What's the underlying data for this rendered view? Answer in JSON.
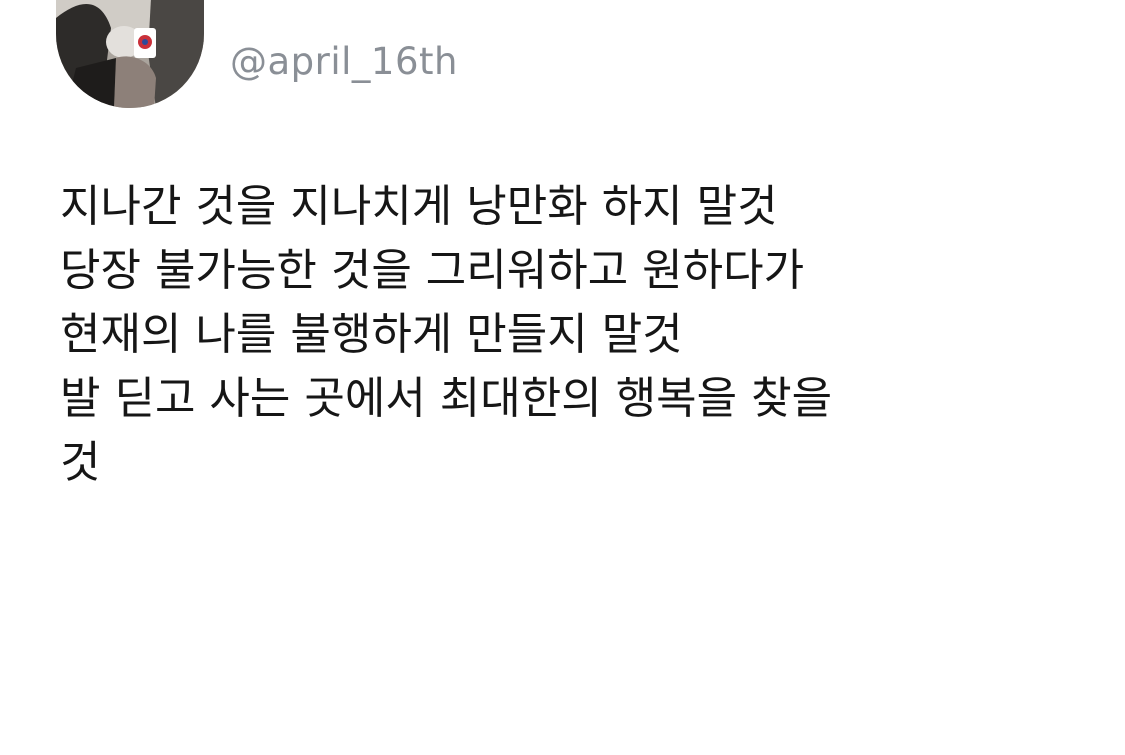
{
  "tweet": {
    "handle": "@april_16th",
    "avatar_icon": "profile-photo",
    "lines": [
      "지나간 것을 지나치게 낭만화 하지 말것",
      "당장 불가능한 것을 그리워하고 원하다가",
      "현재의 나를 불행하게 만들지 말것",
      "발 딛고 사는 곳에서 최대한의 행복을 찾을",
      "것"
    ]
  },
  "colors": {
    "background": "#ffffff",
    "handle": "#8a8f96",
    "text": "#161616"
  }
}
